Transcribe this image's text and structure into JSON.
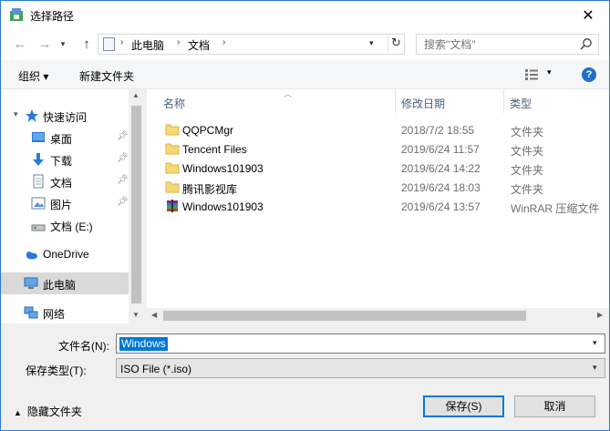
{
  "window": {
    "title": "选择路径"
  },
  "address": {
    "crumbs": [
      "此电脑",
      "文档"
    ],
    "search_placeholder": "搜索\"文档\""
  },
  "toolbar": {
    "organize": "组织 ▾",
    "new_folder": "新建文件夹"
  },
  "nav": {
    "quick_access": "快速访问",
    "items": [
      {
        "label": "桌面",
        "pinned": true
      },
      {
        "label": "下载",
        "pinned": true
      },
      {
        "label": "文档",
        "pinned": true
      },
      {
        "label": "图片",
        "pinned": true
      },
      {
        "label": "文档 (E:)",
        "pinned": false
      }
    ],
    "onedrive": "OneDrive",
    "this_pc": "此电脑",
    "network": "网络"
  },
  "columns": {
    "name": "名称",
    "date": "修改日期",
    "type": "类型"
  },
  "files": [
    {
      "name": "QQPCMgr",
      "date": "2018/7/2 18:55",
      "type": "文件夹",
      "icon": "folder-icon"
    },
    {
      "name": "Tencent Files",
      "date": "2019/6/24 11:57",
      "type": "文件夹",
      "icon": "folder-icon"
    },
    {
      "name": "Windows101903",
      "date": "2019/6/24 14:22",
      "type": "文件夹",
      "icon": "folder-icon"
    },
    {
      "name": "腾讯影视库",
      "date": "2019/6/24 18:03",
      "type": "文件夹",
      "icon": "folder-icon"
    },
    {
      "name": "Windows101903",
      "date": "2019/6/24 13:57",
      "type": "WinRAR 压缩文件",
      "icon": "winrar-archive-icon"
    }
  ],
  "bottom": {
    "filename_label": "文件名(N):",
    "filename_value": "Windows",
    "filetype_label": "保存类型(T):",
    "filetype_value": "ISO File (*.iso)",
    "hide_folders": "隐藏文件夹",
    "save": "保存(S)",
    "cancel": "取消"
  },
  "colors": {
    "accent": "#0078d7",
    "folder": "#f8d775"
  }
}
